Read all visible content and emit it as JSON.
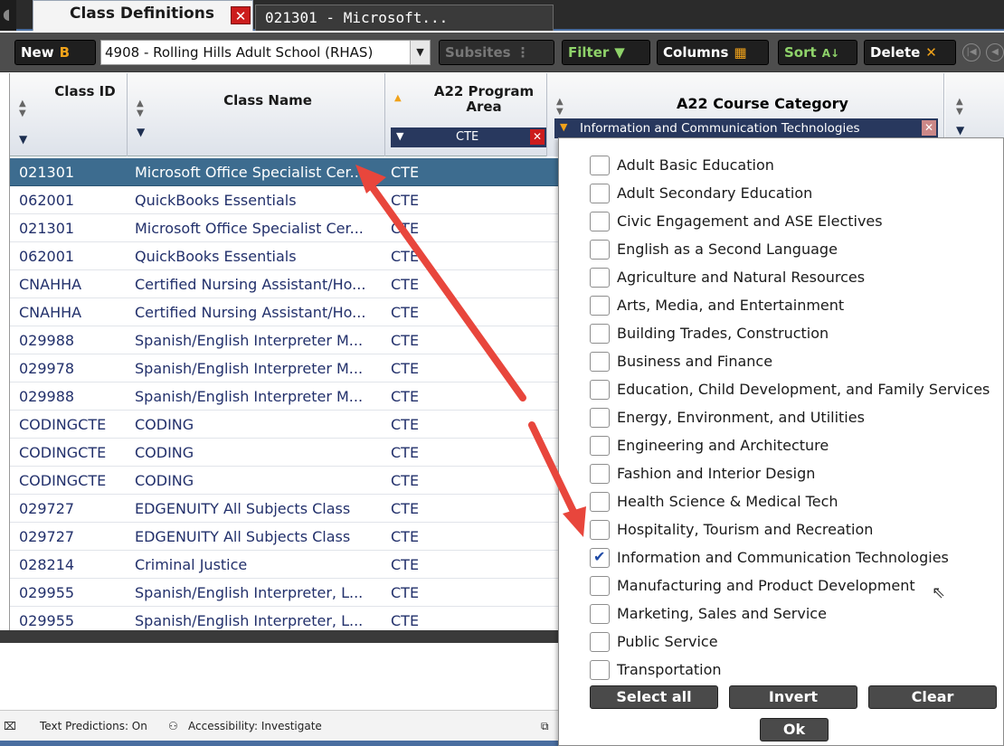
{
  "tabs": {
    "active": "Class Definitions",
    "active_close": "✕",
    "second": "021301 - Microsoft..."
  },
  "toolbar": {
    "new_label": "New",
    "new_icon": "B",
    "site_value": "4908 - Rolling Hills Adult School (RHAS)",
    "subsites_label": "Subsites",
    "filter_label": "Filter",
    "columns_label": "Columns",
    "sort_label": "Sort",
    "sort_icon": "A↓",
    "delete_label": "Delete",
    "delete_icon": "✕"
  },
  "grid": {
    "headers": {
      "class_id": "Class ID",
      "class_name": "Class Name",
      "program_area": "A22 Program Area",
      "course_category": "A22 Course Category"
    },
    "program_area_filter": "CTE",
    "course_category_filter": "Information and Communication Technologies",
    "rows": [
      {
        "id": "021301",
        "name": "Microsoft Office Specialist Cer...",
        "area": "CTE"
      },
      {
        "id": "062001",
        "name": "QuickBooks Essentials",
        "area": "CTE"
      },
      {
        "id": "021301",
        "name": "Microsoft Office Specialist Cer...",
        "area": "CTE"
      },
      {
        "id": "062001",
        "name": "QuickBooks Essentials",
        "area": "CTE"
      },
      {
        "id": "CNAHHA",
        "name": "Certified Nursing Assistant/Ho...",
        "area": "CTE"
      },
      {
        "id": "CNAHHA",
        "name": "Certified Nursing Assistant/Ho...",
        "area": "CTE"
      },
      {
        "id": "029988",
        "name": "Spanish/English Interpreter M...",
        "area": "CTE"
      },
      {
        "id": "029978",
        "name": "Spanish/English Interpreter M...",
        "area": "CTE"
      },
      {
        "id": "029988",
        "name": "Spanish/English Interpreter M...",
        "area": "CTE"
      },
      {
        "id": "CODINGCTE",
        "name": "CODING",
        "area": "CTE"
      },
      {
        "id": "CODINGCTE",
        "name": "CODING",
        "area": "CTE"
      },
      {
        "id": "CODINGCTE",
        "name": "CODING",
        "area": "CTE"
      },
      {
        "id": "029727",
        "name": "EDGENUITY  All Subjects Class",
        "area": "CTE"
      },
      {
        "id": "029727",
        "name": "EDGENUITY  All Subjects Class",
        "area": "CTE"
      },
      {
        "id": "028214",
        "name": "Criminal Justice",
        "area": "CTE"
      },
      {
        "id": "029955",
        "name": "Spanish/English Interpreter,  L...",
        "area": "CTE"
      },
      {
        "id": "029955",
        "name": "Spanish/English Interpreter,  L...",
        "area": "CTE"
      }
    ]
  },
  "filter_panel": {
    "options": [
      {
        "label": "Adult Basic Education",
        "checked": false
      },
      {
        "label": "Adult Secondary Education",
        "checked": false
      },
      {
        "label": "Civic Engagement and ASE Electives",
        "checked": false
      },
      {
        "label": "English as a Second Language",
        "checked": false
      },
      {
        "label": "Agriculture and Natural Resources",
        "checked": false
      },
      {
        "label": "Arts, Media, and Entertainment",
        "checked": false
      },
      {
        "label": "Building Trades, Construction",
        "checked": false
      },
      {
        "label": "Business and Finance",
        "checked": false
      },
      {
        "label": "Education, Child Development, and Family Services",
        "checked": false
      },
      {
        "label": "Energy, Environment, and Utilities",
        "checked": false
      },
      {
        "label": "Engineering and Architecture",
        "checked": false
      },
      {
        "label": "Fashion and Interior Design",
        "checked": false
      },
      {
        "label": "Health Science & Medical Tech",
        "checked": false
      },
      {
        "label": "Hospitality, Tourism and Recreation",
        "checked": false
      },
      {
        "label": "Information and Communication Technologies",
        "checked": true
      },
      {
        "label": "Manufacturing and Product Development",
        "checked": false
      },
      {
        "label": "Marketing, Sales and Service",
        "checked": false
      },
      {
        "label": "Public Service",
        "checked": false
      },
      {
        "label": "Transportation",
        "checked": false
      }
    ],
    "select_all_label": "Select all",
    "invert_label": "Invert",
    "clear_label": "Clear",
    "ok_label": "Ok"
  },
  "statusbar": {
    "text_predictions": "Text Predictions: On",
    "accessibility": "Accessibility: Investigate"
  },
  "colors": {
    "annotation_arrow": "#e8463c",
    "selected_row": "#3d6c8f",
    "filter_bg": "#28385e"
  }
}
